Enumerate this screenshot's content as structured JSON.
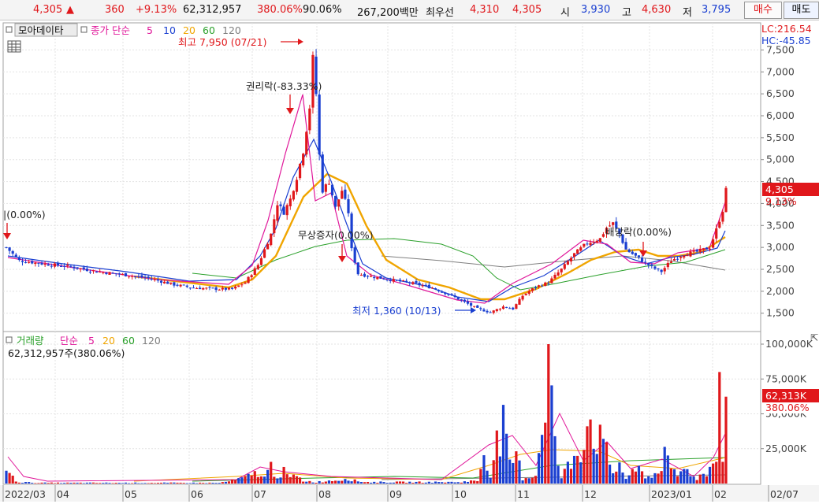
{
  "quote": {
    "price": "4,305",
    "change": "360",
    "change_pct": "+9.13%",
    "volume": "62,312,957",
    "volume_ratio": "380.06%",
    "turnover": "90.06%",
    "amount": "267,200백만",
    "best_ask_label": "최우선",
    "best_ask": "4,310",
    "best_bid": "4,305",
    "open_label": "시",
    "open": "3,930",
    "high_label": "고",
    "high": "4,630",
    "low_label": "저",
    "low": "3,795"
  },
  "buttons": {
    "buy": "매수",
    "sell": "매도"
  },
  "price_panel": {
    "source_label": "모아데이타",
    "indicator_label": "종가 단순",
    "ma_periods": [
      "5",
      "10",
      "20",
      "60",
      "120"
    ],
    "ma_colors": [
      "#e0179a",
      "#1a3fd1",
      "#f0a500",
      "#2aa02a",
      "#7f7f7f"
    ],
    "lc": "LC:216.54",
    "hc": "HC:-45.85",
    "price_tag": "4,305",
    "pct_tag": "9.13%",
    "annotations": {
      "high": "최고 7,950 (07/21)",
      "rights": "권리락(-83.33%)",
      "bonus": "무상증자(0.00%)",
      "low": "최저 1,360 (10/13)",
      "dividend": "배당락(0.00%)",
      "left_cut": "|(0.00%)"
    }
  },
  "volume_panel": {
    "label": "거래량",
    "indicator_label": "단순",
    "ma_periods": [
      "5",
      "20",
      "60",
      "120"
    ],
    "summary": "62,312,957주(380.06%)",
    "vol_tag": "62,313K",
    "pct_tag": "380.06%"
  },
  "x_labels": [
    "2022/03",
    "04",
    "05",
    "06",
    "07",
    "08",
    "09",
    "10",
    "11",
    "12",
    "2023/01",
    "02",
    "02/07"
  ],
  "chart_data": {
    "type": "candlestick",
    "y_ticks": [
      "1,500",
      "2,000",
      "2,500",
      "3,000",
      "3,500",
      "4,000",
      "4,500",
      "5,000",
      "5,500",
      "6,000",
      "6,500",
      "7,000",
      "7,500"
    ],
    "ylim": [
      1100,
      8100
    ],
    "vol_ticks": [
      "25,000K",
      "50,000K",
      "75,000K",
      "100,000K"
    ],
    "vol_ylim": [
      0,
      100000
    ],
    "close_path": [
      [
        0,
        3000
      ],
      [
        4,
        2700
      ],
      [
        12,
        2620
      ],
      [
        20,
        2560
      ],
      [
        28,
        2450
      ],
      [
        36,
        2380
      ],
      [
        44,
        2300
      ],
      [
        52,
        2150
      ],
      [
        58,
        2080
      ],
      [
        66,
        2050
      ],
      [
        70,
        2050
      ],
      [
        74,
        2200
      ],
      [
        78,
        2600
      ],
      [
        82,
        3300
      ],
      [
        84,
        4000
      ],
      [
        86,
        3800
      ],
      [
        88,
        4100
      ],
      [
        90,
        4600
      ],
      [
        92,
        5200
      ],
      [
        94,
        6200
      ],
      [
        95,
        7300
      ],
      [
        96,
        6500
      ],
      [
        97,
        5100
      ],
      [
        98,
        4300
      ],
      [
        100,
        4500
      ],
      [
        102,
        3900
      ],
      [
        104,
        4300
      ],
      [
        106,
        3800
      ],
      [
        107,
        2950
      ],
      [
        109,
        2400
      ],
      [
        112,
        2350
      ],
      [
        116,
        2300
      ],
      [
        120,
        2250
      ],
      [
        126,
        2180
      ],
      [
        132,
        2080
      ],
      [
        138,
        1900
      ],
      [
        142,
        1750
      ],
      [
        146,
        1600
      ],
      [
        150,
        1520
      ],
      [
        154,
        1650
      ],
      [
        157,
        1600
      ],
      [
        160,
        1900
      ],
      [
        164,
        2100
      ],
      [
        168,
        2200
      ],
      [
        172,
        2500
      ],
      [
        176,
        2850
      ],
      [
        180,
        3100
      ],
      [
        184,
        3200
      ],
      [
        186,
        3450
      ],
      [
        188,
        3550
      ],
      [
        190,
        3300
      ],
      [
        192,
        2950
      ],
      [
        196,
        2750
      ],
      [
        200,
        2550
      ],
      [
        203,
        2450
      ],
      [
        206,
        2700
      ],
      [
        210,
        2850
      ],
      [
        214,
        2900
      ],
      [
        218,
        3000
      ],
      [
        220,
        3400
      ],
      [
        222,
        3850
      ],
      [
        223,
        4305
      ]
    ],
    "volume_path": [
      [
        0,
        10
      ],
      [
        2,
        4
      ],
      [
        4,
        1
      ],
      [
        10,
        0.5
      ],
      [
        30,
        0.5
      ],
      [
        50,
        0.5
      ],
      [
        66,
        0.5
      ],
      [
        70,
        2
      ],
      [
        74,
        4
      ],
      [
        78,
        8
      ],
      [
        80,
        4
      ],
      [
        82,
        12
      ],
      [
        84,
        6
      ],
      [
        86,
        8
      ],
      [
        88,
        4
      ],
      [
        90,
        5
      ],
      [
        92,
        2
      ],
      [
        96,
        1
      ],
      [
        100,
        2
      ],
      [
        104,
        3
      ],
      [
        106,
        4
      ],
      [
        108,
        2
      ],
      [
        112,
        1
      ],
      [
        140,
        1
      ],
      [
        146,
        2
      ],
      [
        148,
        22
      ],
      [
        150,
        8
      ],
      [
        152,
        28
      ],
      [
        154,
        38
      ],
      [
        156,
        12
      ],
      [
        158,
        20
      ],
      [
        160,
        4
      ],
      [
        164,
        6
      ],
      [
        166,
        42
      ],
      [
        168,
        100
      ],
      [
        170,
        26
      ],
      [
        172,
        4
      ],
      [
        176,
        20
      ],
      [
        178,
        26
      ],
      [
        180,
        48
      ],
      [
        184,
        30
      ],
      [
        186,
        20
      ],
      [
        188,
        8
      ],
      [
        190,
        14
      ],
      [
        192,
        4
      ],
      [
        196,
        10
      ],
      [
        198,
        6
      ],
      [
        200,
        4
      ],
      [
        204,
        18
      ],
      [
        206,
        9
      ],
      [
        208,
        6
      ],
      [
        210,
        10
      ],
      [
        212,
        8
      ],
      [
        214,
        4
      ],
      [
        217,
        8
      ],
      [
        219,
        14
      ],
      [
        220,
        28
      ],
      [
        221,
        80
      ],
      [
        222,
        14
      ],
      [
        223,
        62
      ]
    ]
  }
}
